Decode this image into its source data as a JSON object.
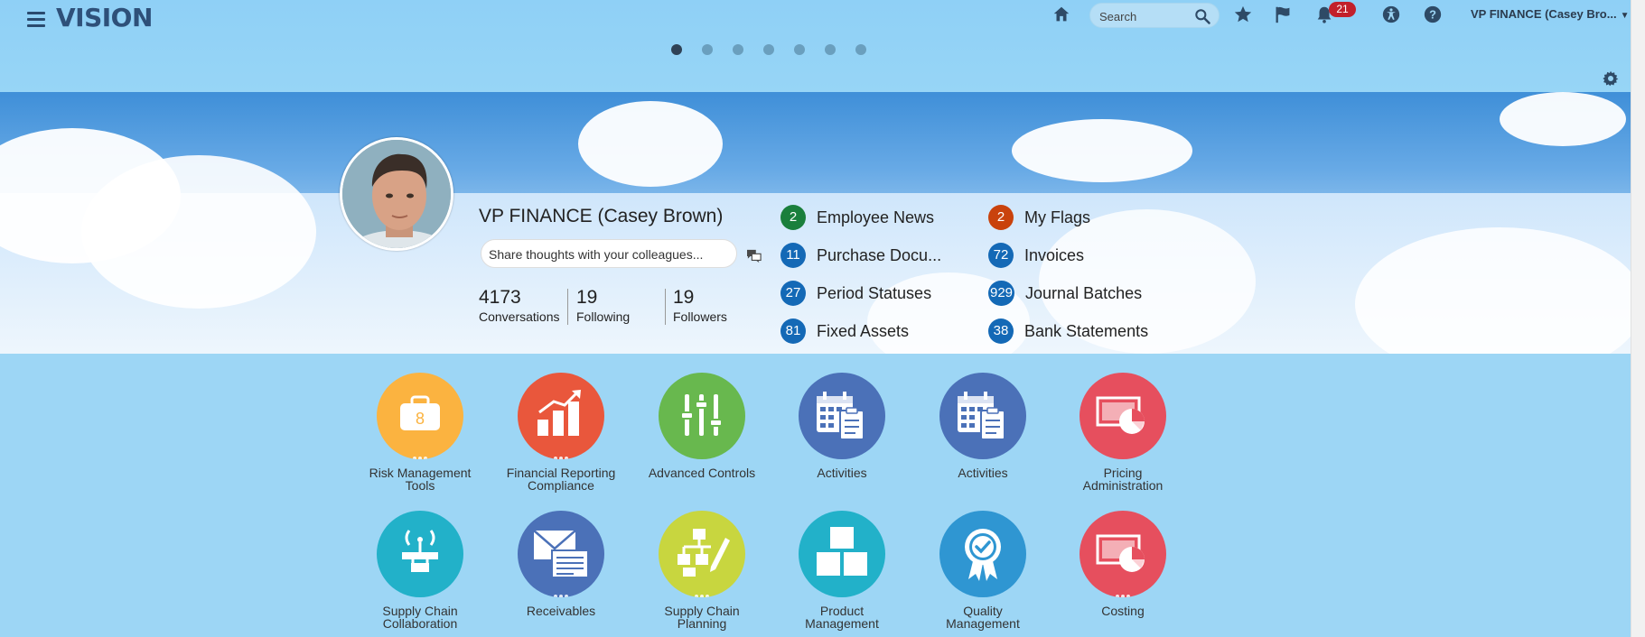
{
  "app": {
    "logo": "VISION"
  },
  "header": {
    "search_placeholder": "Search",
    "notification_count": "21",
    "user_menu": "VP FINANCE (Casey Bro..."
  },
  "carousel": {
    "page_count": 7,
    "active_page": 1
  },
  "profile": {
    "name": "VP FINANCE (Casey Brown)",
    "share_placeholder": "Share thoughts with your colleagues...",
    "stats": [
      {
        "value": "4173",
        "label": "Conversations"
      },
      {
        "value": "19",
        "label": "Following"
      },
      {
        "value": "19",
        "label": "Followers"
      }
    ]
  },
  "notifications": [
    {
      "count": "2",
      "label": "Employee News",
      "color": "#1a7f3c"
    },
    {
      "count": "11",
      "label": "Purchase Docu...",
      "color": "#1469b6"
    },
    {
      "count": "27",
      "label": "Period Statuses",
      "color": "#1469b6"
    },
    {
      "count": "81",
      "label": "Fixed Assets",
      "color": "#1469b6"
    },
    {
      "count": "2",
      "label": "My Flags",
      "color": "#c9420c"
    },
    {
      "count": "72",
      "label": "Invoices",
      "color": "#1469b6"
    },
    {
      "count": "929",
      "label": "Journal Batches",
      "color": "#1469b6"
    },
    {
      "count": "38",
      "label": "Bank Statements",
      "color": "#1469b6"
    }
  ],
  "tiles": [
    {
      "label": "Risk Management Tools",
      "line1": "Risk Management",
      "line2": "Tools",
      "color": "#fbb340",
      "icon": "briefcase-icon",
      "has_dots": true
    },
    {
      "label": "Financial Reporting Compliance",
      "line1": "Financial Reporting",
      "line2": "Compliance",
      "color": "#e9573c",
      "icon": "bar-chart-icon",
      "has_dots": true
    },
    {
      "label": "Advanced Controls",
      "line1": "Advanced Controls",
      "line2": "",
      "color": "#68b84e",
      "icon": "sliders-icon",
      "has_dots": false
    },
    {
      "label": "Activities",
      "line1": "Activities",
      "line2": "",
      "color": "#4b71b8",
      "icon": "calendar-clipboard-icon",
      "has_dots": false
    },
    {
      "label": "Activities",
      "line1": "Activities",
      "line2": "",
      "color": "#4b71b8",
      "icon": "calendar-clipboard-icon",
      "has_dots": false
    },
    {
      "label": "Pricing Administration",
      "line1": "Pricing",
      "line2": "Administration",
      "color": "#e64f5e",
      "icon": "money-chart-icon",
      "has_dots": false
    },
    {
      "label": "Supply Chain Collaboration",
      "line1": "Supply Chain",
      "line2": "Collaboration",
      "color": "#22b1c9",
      "icon": "antenna-network-icon",
      "has_dots": false
    },
    {
      "label": "Receivables",
      "line1": "Receivables",
      "line2": "",
      "color": "#4b71b8",
      "icon": "envelope-document-icon",
      "has_dots": true
    },
    {
      "label": "Supply Chain Planning",
      "line1": "Supply Chain",
      "line2": "Planning",
      "color": "#c8d63f",
      "icon": "hierarchy-pencil-icon",
      "has_dots": true
    },
    {
      "label": "Product Management",
      "line1": "Product",
      "line2": "Management",
      "color": "#22b1c9",
      "icon": "boxes-icon",
      "has_dots": false
    },
    {
      "label": "Quality Management",
      "line1": "Quality",
      "line2": "Management",
      "color": "#2f96d2",
      "icon": "award-ribbon-icon",
      "has_dots": false
    },
    {
      "label": "Costing",
      "line1": "Costing",
      "line2": "",
      "color": "#e64f5e",
      "icon": "money-chart-icon",
      "has_dots": true
    }
  ]
}
